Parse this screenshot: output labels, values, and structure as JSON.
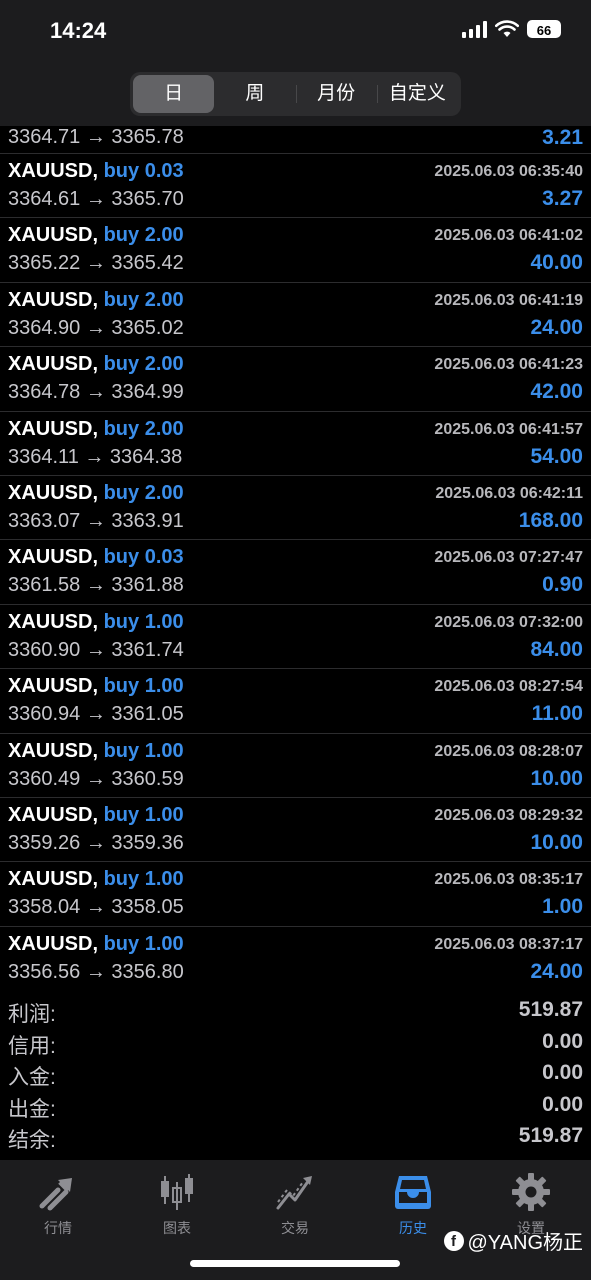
{
  "status_bar": {
    "time": "14:24",
    "battery": "66"
  },
  "period_tabs": [
    "日",
    "周",
    "月份",
    "自定义"
  ],
  "active_period": "日",
  "first_partial": {
    "prices": "3364.71 → 3365.78",
    "profit": "3.21"
  },
  "trades": [
    {
      "symbol": "XAUUSD,",
      "side_volume": "buy 0.03",
      "datetime": "2025.06.03 06:35:40",
      "prices": "3364.61 → 3365.70",
      "profit": "3.27"
    },
    {
      "symbol": "XAUUSD,",
      "side_volume": "buy 2.00",
      "datetime": "2025.06.03 06:41:02",
      "prices": "3365.22 → 3365.42",
      "profit": "40.00"
    },
    {
      "symbol": "XAUUSD,",
      "side_volume": "buy 2.00",
      "datetime": "2025.06.03 06:41:19",
      "prices": "3364.90 → 3365.02",
      "profit": "24.00"
    },
    {
      "symbol": "XAUUSD,",
      "side_volume": "buy 2.00",
      "datetime": "2025.06.03 06:41:23",
      "prices": "3364.78 → 3364.99",
      "profit": "42.00"
    },
    {
      "symbol": "XAUUSD,",
      "side_volume": "buy 2.00",
      "datetime": "2025.06.03 06:41:57",
      "prices": "3364.11 → 3364.38",
      "profit": "54.00"
    },
    {
      "symbol": "XAUUSD,",
      "side_volume": "buy 2.00",
      "datetime": "2025.06.03 06:42:11",
      "prices": "3363.07 → 3363.91",
      "profit": "168.00"
    },
    {
      "symbol": "XAUUSD,",
      "side_volume": "buy 0.03",
      "datetime": "2025.06.03 07:27:47",
      "prices": "3361.58 → 3361.88",
      "profit": "0.90"
    },
    {
      "symbol": "XAUUSD,",
      "side_volume": "buy 1.00",
      "datetime": "2025.06.03 07:32:00",
      "prices": "3360.90 → 3361.74",
      "profit": "84.00"
    },
    {
      "symbol": "XAUUSD,",
      "side_volume": "buy 1.00",
      "datetime": "2025.06.03 08:27:54",
      "prices": "3360.94 → 3361.05",
      "profit": "11.00"
    },
    {
      "symbol": "XAUUSD,",
      "side_volume": "buy 1.00",
      "datetime": "2025.06.03 08:28:07",
      "prices": "3360.49 → 3360.59",
      "profit": "10.00"
    },
    {
      "symbol": "XAUUSD,",
      "side_volume": "buy 1.00",
      "datetime": "2025.06.03 08:29:32",
      "prices": "3359.26 → 3359.36",
      "profit": "10.00"
    },
    {
      "symbol": "XAUUSD,",
      "side_volume": "buy 1.00",
      "datetime": "2025.06.03 08:35:17",
      "prices": "3358.04 → 3358.05",
      "profit": "1.00"
    },
    {
      "symbol": "XAUUSD,",
      "side_volume": "buy 1.00",
      "datetime": "2025.06.03 08:37:17",
      "prices": "3356.56 → 3356.80",
      "profit": "24.00"
    }
  ],
  "summary": [
    {
      "label": "利润:",
      "value": "519.87"
    },
    {
      "label": "信用:",
      "value": "0.00"
    },
    {
      "label": "入金:",
      "value": "0.00"
    },
    {
      "label": "出金:",
      "value": "0.00"
    },
    {
      "label": "结余:",
      "value": "519.87"
    }
  ],
  "tabbar": [
    {
      "label": "行情",
      "icon": "quotes-arrows-icon"
    },
    {
      "label": "图表",
      "icon": "candlestick-chart-icon"
    },
    {
      "label": "交易",
      "icon": "trade-trend-icon"
    },
    {
      "label": "历史",
      "icon": "history-inbox-icon"
    },
    {
      "label": "设置",
      "icon": "gear-icon"
    }
  ],
  "active_tab": "历史",
  "watermark": "@YANG杨正",
  "colors": {
    "accent": "#3b8eea",
    "background": "#000000",
    "bar": "#1c1c1e"
  }
}
